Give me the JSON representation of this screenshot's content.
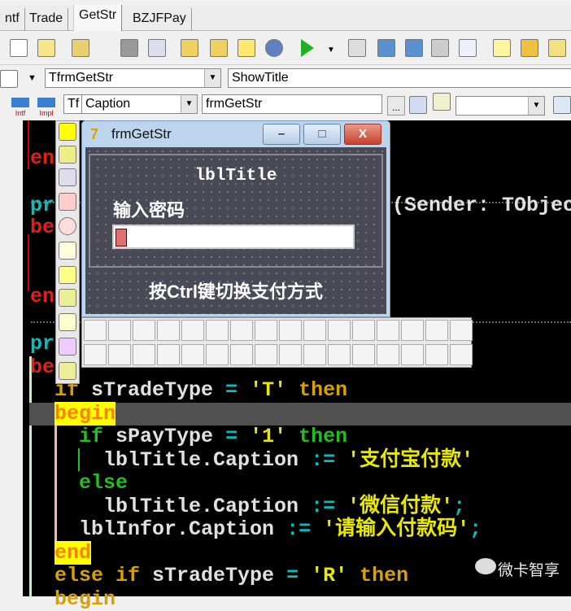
{
  "tabs": [
    {
      "label": "ntf"
    },
    {
      "label": "Trade"
    },
    {
      "label": "GetStr"
    },
    {
      "label": "BZJFPay"
    }
  ],
  "toolbar2": {
    "class_combo": "TfrmGetStr",
    "method_combo": "ShowTitle"
  },
  "toolbar3": {
    "intf_label": "Intf",
    "impl_label": "Impl",
    "type_combo": "Tf",
    "property_combo": "Caption",
    "value_edit": "frmGetStr",
    "ellipsis": "...",
    "extra_combo": ""
  },
  "form": {
    "title": "frmGetStr",
    "lbl_title": "lblTitle",
    "prompt": "输入密码",
    "hint": "按Ctrl键切换支付方式",
    "edit_value": "",
    "min": "–",
    "max": "□",
    "close": "X"
  },
  "code_fragments": {
    "en1": "en",
    "pr1": "pr",
    "sender": "(Sender: TObject",
    "be1": "be",
    "en2": "en",
    "pr2": "pr",
    "be2": "be"
  },
  "code_lines": [
    [
      [
        "if ",
        "kw"
      ],
      [
        "sTradeType ",
        "id"
      ],
      [
        "= ",
        "op"
      ],
      [
        "'T' ",
        "str"
      ],
      [
        "then",
        "kw"
      ]
    ],
    [
      [
        "begin",
        "hl"
      ]
    ],
    [
      [
        "  ",
        " "
      ],
      [
        "if ",
        "kwg"
      ],
      [
        "sPayType ",
        "id"
      ],
      [
        "= ",
        "op"
      ],
      [
        "'1' ",
        "str"
      ],
      [
        "then",
        "kwg"
      ]
    ],
    [
      [
        "    ",
        " "
      ],
      [
        "lblTitle.",
        "id"
      ],
      [
        "Caption ",
        "id"
      ],
      [
        ":= ",
        "op"
      ],
      [
        "'支付宝付款'",
        "str"
      ]
    ],
    [
      [
        "  ",
        " "
      ],
      [
        "else",
        "kwg"
      ]
    ],
    [
      [
        "    ",
        " "
      ],
      [
        "lblTitle.",
        "id"
      ],
      [
        "Caption ",
        "id"
      ],
      [
        ":= ",
        "op"
      ],
      [
        "'微信付款'",
        "str"
      ],
      [
        ";",
        "op"
      ]
    ],
    [
      [
        "  ",
        " "
      ],
      [
        "lblInfor.",
        "id"
      ],
      [
        "Caption ",
        "id"
      ],
      [
        ":= ",
        "op"
      ],
      [
        "'请输入付款码'",
        "str"
      ],
      [
        ";",
        "op"
      ]
    ],
    [
      [
        "end",
        "hl"
      ]
    ],
    [
      [
        "else if ",
        "kw"
      ],
      [
        "sTradeType ",
        "id"
      ],
      [
        "= ",
        "op"
      ],
      [
        "'R' ",
        "str"
      ],
      [
        "then",
        "kw"
      ]
    ],
    [
      [
        "begin",
        "kw"
      ]
    ]
  ],
  "watermark": "微卡智享"
}
